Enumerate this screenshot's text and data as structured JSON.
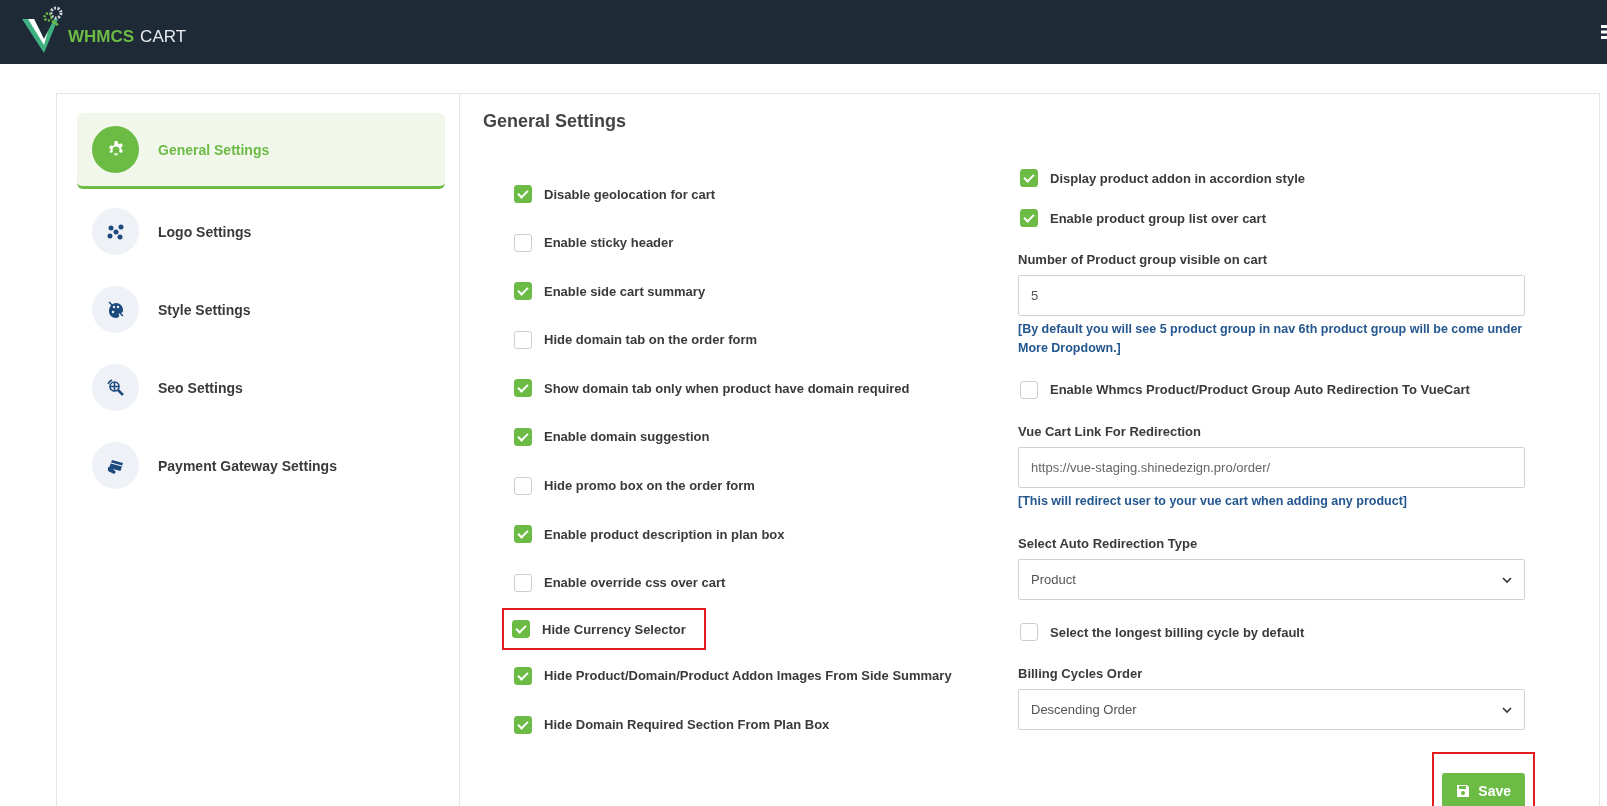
{
  "header": {
    "logo_brand": "WHMCS",
    "logo_product": "CART"
  },
  "sidebar": {
    "items": [
      {
        "label": "General Settings",
        "selected": true
      },
      {
        "label": "Logo Settings",
        "selected": false
      },
      {
        "label": "Style Settings",
        "selected": false
      },
      {
        "label": "Seo Settings",
        "selected": false
      },
      {
        "label": "Payment Gateway Settings",
        "selected": false
      }
    ]
  },
  "content": {
    "title": "General Settings",
    "left_options": [
      {
        "label": "Disable geolocation for cart",
        "checked": true,
        "highlighted": false
      },
      {
        "label": "Enable sticky header",
        "checked": false,
        "highlighted": false
      },
      {
        "label": "Enable side cart summary",
        "checked": true,
        "highlighted": false
      },
      {
        "label": "Hide domain tab on the order form",
        "checked": false,
        "highlighted": false
      },
      {
        "label": "Show domain tab only when product have domain required",
        "checked": true,
        "highlighted": false
      },
      {
        "label": "Enable domain suggestion",
        "checked": true,
        "highlighted": false
      },
      {
        "label": "Hide promo box on the order form",
        "checked": false,
        "highlighted": false
      },
      {
        "label": "Enable product description in plan box",
        "checked": true,
        "highlighted": false
      },
      {
        "label": "Enable override css over cart",
        "checked": false,
        "highlighted": false
      },
      {
        "label": "Hide Currency Selector",
        "checked": true,
        "highlighted": true
      },
      {
        "label": "Hide Product/Domain/Product Addon Images From Side Summary",
        "checked": true,
        "highlighted": false
      },
      {
        "label": "Hide Domain Required Section From Plan Box",
        "checked": true,
        "highlighted": false
      }
    ],
    "right_options": [
      {
        "kind": "checkbox",
        "label": "Display product addon in accordion style",
        "checked": true
      },
      {
        "kind": "checkbox",
        "label": "Enable product group list over cart",
        "checked": true
      },
      {
        "kind": "input",
        "label": "Number of Product group visible on cart",
        "value": "5",
        "note": "[By default you will see 5 product group in nav 6th product group will be come under More Dropdown.]"
      },
      {
        "kind": "checkbox",
        "label": "Enable Whmcs Product/Product Group Auto Redirection To VueCart",
        "checked": false
      },
      {
        "kind": "input",
        "label": "Vue Cart Link For Redirection",
        "placeholder": "https://vue-staging.shinedezign.pro/order/",
        "note": "[This will redirect user to your vue cart when adding any product]"
      },
      {
        "kind": "select",
        "label": "Select Auto Redirection Type",
        "value": "Product"
      },
      {
        "kind": "checkbox",
        "label": "Select the longest billing cycle by default",
        "checked": false
      },
      {
        "kind": "select",
        "label": "Billing Cycles Order",
        "value": "Descending Order"
      }
    ],
    "save_button": {
      "label": "Save",
      "highlighted": true
    }
  }
}
